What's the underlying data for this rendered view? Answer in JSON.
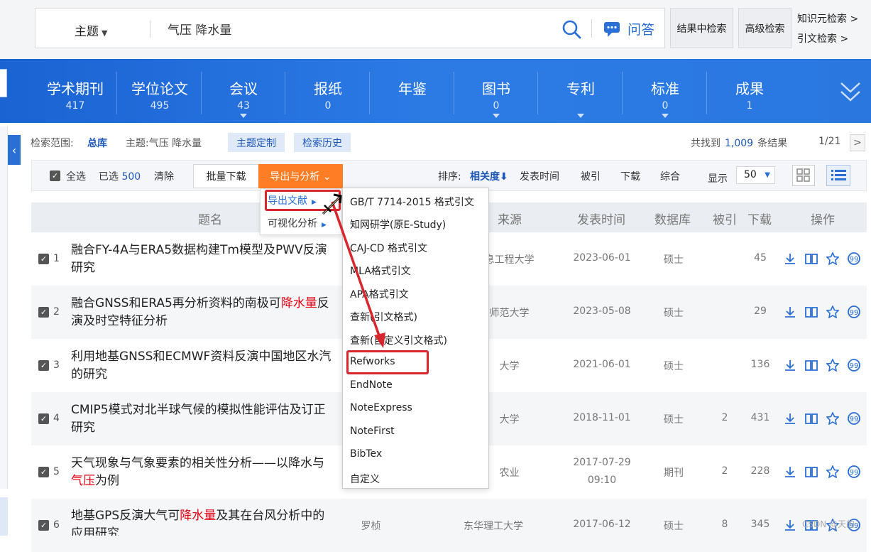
{
  "search": {
    "field": "主题",
    "query": "气压 降水量",
    "qa_label": "问答",
    "result_search": "结果中检索",
    "advanced_search": "高级检索",
    "knowledge_search": "知识元检索 >",
    "citation_search": "引文检索 >"
  },
  "databases": [
    {
      "name": "学术期刊",
      "count": "417"
    },
    {
      "name": "学位论文",
      "count": "495"
    },
    {
      "name": "会议",
      "count": "43"
    },
    {
      "name": "报纸",
      "count": "0"
    },
    {
      "name": "年鉴",
      "count": ""
    },
    {
      "name": "图书",
      "count": "0"
    },
    {
      "name": "专利",
      "count": ""
    },
    {
      "name": "标准",
      "count": "0"
    },
    {
      "name": "成果",
      "count": "1"
    }
  ],
  "meta": {
    "scope_label": "检索范围:",
    "scope_value": "总库",
    "topic": "主题:气压 降水量",
    "custom_topic": "主题定制",
    "history": "检索历史",
    "found_prefix": "共找到",
    "found_count": "1,009",
    "found_suffix": "条结果",
    "page": "1/21",
    "page_next": ">"
  },
  "toolbar": {
    "select_all": "全选",
    "selected_prefix": "已选",
    "selected_count": "500",
    "clear": "清除",
    "bulk_download": "批量下载",
    "export": "导出与分析 ⌄",
    "sort_label": "排序:",
    "sort_relevance": "相关度⬇",
    "sort_date": "发表时间",
    "sort_cited": "被引",
    "sort_downloads": "下载",
    "sort_combined": "综合",
    "show_label": "显示",
    "page_size": "50"
  },
  "table": {
    "headers": {
      "title": "题名",
      "source": "来源",
      "date": "发表时间",
      "db": "数据库",
      "cited": "被引",
      "downloads": "下载",
      "ops": "操作"
    },
    "rows": [
      {
        "num": "1",
        "t1": "融合FY-4A与ERA5数据构建Tm模型及PWV反演",
        "t1h": "",
        "t1r": "",
        "t2": "研究",
        "t2h": "",
        "t2r": "",
        "author": "",
        "source": "息工程大学",
        "date": "2023-06-01",
        "date2": "",
        "db": "硕士",
        "cited": "",
        "downloads": "45"
      },
      {
        "num": "2",
        "t1": "融合GNSS和ERA5再分析资料的南极可",
        "t1h": "降水量",
        "t1r": "反",
        "t2": "演及时空特征分析",
        "t2h": "",
        "t2r": "",
        "author": "",
        "source": "师范大学",
        "date": "2023-05-08",
        "date2": "",
        "db": "硕士",
        "cited": "",
        "downloads": "29"
      },
      {
        "num": "3",
        "t1": "利用地基GNSS和ECMWF资料反演中国地区水汽",
        "t1h": "",
        "t1r": "",
        "t2": "的研究",
        "t2h": "",
        "t2r": "",
        "author": "",
        "source": "大学",
        "date": "2021-06-01",
        "date2": "",
        "db": "硕士",
        "cited": "",
        "downloads": "136"
      },
      {
        "num": "4",
        "t1": "CMIP5模式对北半球气候的模拟性能评估及订正",
        "t1h": "",
        "t1r": "",
        "t2": "研究",
        "t2h": "",
        "t2r": "",
        "author": "",
        "source": "大学",
        "date": "2018-11-01",
        "date2": "",
        "db": "硕士",
        "cited": "2",
        "downloads": "431"
      },
      {
        "num": "5",
        "t1": "天气现象与气象要素的相关性分析——以降水与",
        "t1h": "",
        "t1r": "",
        "t2": "",
        "t2h": "气压",
        "t2r": "为例",
        "author": "",
        "source": "农业",
        "date": "2017-07-29",
        "date2": "09:10",
        "db": "期刊",
        "cited": "2",
        "downloads": "228"
      },
      {
        "num": "6",
        "t1": "地基GPS反演大气可",
        "t1h": "降水量",
        "t1r": "及其在台风分析中的",
        "t2": "应用研究",
        "t2h": "",
        "t2r": "",
        "author": "罗桢",
        "source": "东华理工大学",
        "date": "2017-06-12",
        "date2": "",
        "db": "硕士",
        "cited": "8",
        "downloads": "345"
      }
    ]
  },
  "menu_export": {
    "items": [
      "导出文献",
      "可视化分析"
    ]
  },
  "menu_formats": {
    "items": [
      "GB/T 7714-2015 格式引文",
      "知网研学(原E-Study)",
      "CAJ-CD 格式引文",
      "MLA格式引文",
      "APA格式引文",
      "查新(引文格式)",
      "查新(自定义引文格式)",
      "Refworks",
      "EndNote",
      "NoteExpress",
      "NoteFirst",
      "BibTex",
      "自定义"
    ]
  },
  "watermark": "CSDN @天的",
  "colors": {
    "brand_blue": "#2a6fd6",
    "band": "#1a63d3",
    "export_orange": "#ff7d24",
    "annotation_red": "#d7262d",
    "highlight_red": "#e60012"
  }
}
